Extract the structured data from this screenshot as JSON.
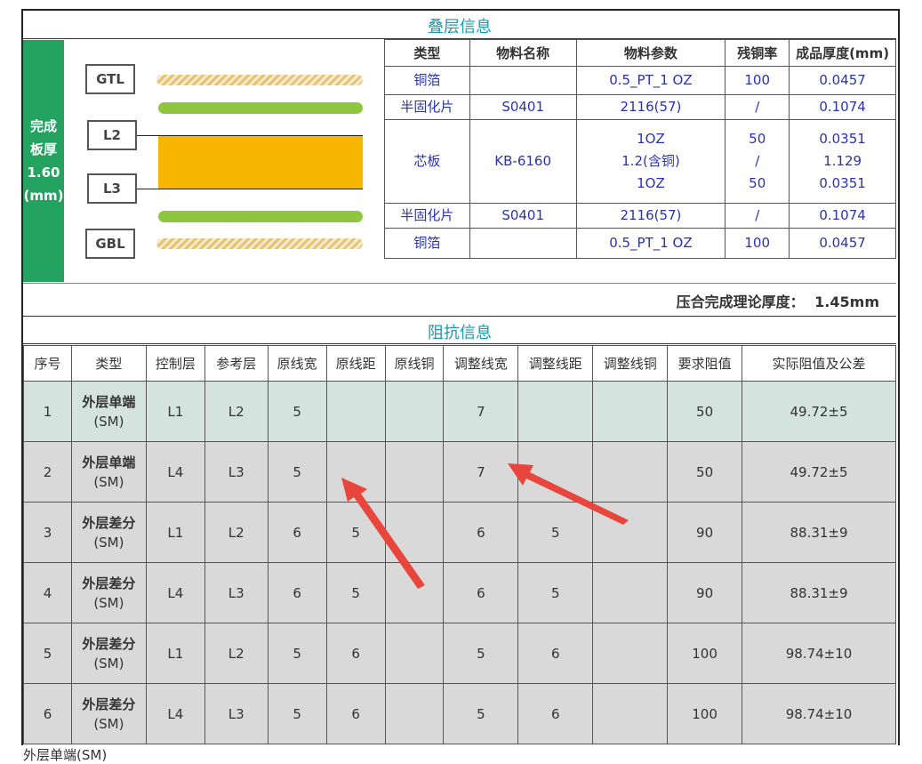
{
  "stack": {
    "title": "叠层信息",
    "side_label": [
      "完成",
      "板厚",
      "1.60",
      "(mm)"
    ],
    "layer_labels": [
      "GTL",
      "L2",
      "L3",
      "GBL"
    ],
    "headers": [
      "类型",
      "物料名称",
      "物料参数",
      "残铜率",
      "成品厚度(mm)"
    ],
    "rows": [
      {
        "type": "铜箔",
        "name": "",
        "param": [
          "0.5_PT_1 OZ"
        ],
        "copper": [
          "100"
        ],
        "thickness": [
          "0.0457"
        ]
      },
      {
        "type": "半固化片",
        "name": "S0401",
        "param": [
          "2116(57)"
        ],
        "copper": [
          "/"
        ],
        "thickness": [
          "0.1074"
        ]
      },
      {
        "type": "芯板",
        "name": "KB-6160",
        "param": [
          "1OZ",
          "1.2(含铜)",
          "1OZ"
        ],
        "copper": [
          "50",
          "/",
          "50"
        ],
        "thickness": [
          "0.0351",
          "1.129",
          "0.0351"
        ]
      },
      {
        "type": "半固化片",
        "name": "S0401",
        "param": [
          "2116(57)"
        ],
        "copper": [
          "/"
        ],
        "thickness": [
          "0.1074"
        ]
      },
      {
        "type": "铜箔",
        "name": "",
        "param": [
          "0.5_PT_1 OZ"
        ],
        "copper": [
          "100"
        ],
        "thickness": [
          "0.0457"
        ]
      }
    ],
    "theory_label": "压合完成理论厚度：",
    "theory_value": "1.45mm"
  },
  "impedance": {
    "title": "阻抗信息",
    "headers": [
      "序号",
      "类型",
      "控制层",
      "参考层",
      "原线宽",
      "原线距",
      "原线铜",
      "调整线宽",
      "调整线距",
      "调整线铜",
      "要求阻值",
      "实际阻值及公差"
    ],
    "rows": [
      {
        "no": "1",
        "type": "外层单端",
        "sub": "(SM)",
        "ctrl": "L1",
        "ref": "L2",
        "ow": "5",
        "os": "",
        "oc": "",
        "aw": "7",
        "as": "",
        "ac": "",
        "req": "50",
        "actual": "49.72±5"
      },
      {
        "no": "2",
        "type": "外层单端",
        "sub": "(SM)",
        "ctrl": "L4",
        "ref": "L3",
        "ow": "5",
        "os": "",
        "oc": "",
        "aw": "7",
        "as": "",
        "ac": "",
        "req": "50",
        "actual": "49.72±5"
      },
      {
        "no": "3",
        "type": "外层差分",
        "sub": "(SM)",
        "ctrl": "L1",
        "ref": "L2",
        "ow": "6",
        "os": "5",
        "oc": "",
        "aw": "6",
        "as": "5",
        "ac": "",
        "req": "90",
        "actual": "88.31±9"
      },
      {
        "no": "4",
        "type": "外层差分",
        "sub": "(SM)",
        "ctrl": "L4",
        "ref": "L3",
        "ow": "6",
        "os": "5",
        "oc": "",
        "aw": "6",
        "as": "5",
        "ac": "",
        "req": "90",
        "actual": "88.31±9"
      },
      {
        "no": "5",
        "type": "外层差分",
        "sub": "(SM)",
        "ctrl": "L1",
        "ref": "L2",
        "ow": "5",
        "os": "6",
        "oc": "",
        "aw": "5",
        "as": "6",
        "ac": "",
        "req": "100",
        "actual": "98.74±10"
      },
      {
        "no": "6",
        "type": "外层差分",
        "sub": "(SM)",
        "ctrl": "L4",
        "ref": "L3",
        "ow": "5",
        "os": "6",
        "oc": "",
        "aw": "5",
        "as": "6",
        "ac": "",
        "req": "100",
        "actual": "98.74±10"
      }
    ]
  },
  "footer_text": "外层单端(SM)",
  "colors": {
    "side_green": "#24a260",
    "title_teal": "#1a9bb0",
    "arrow_red": "#e8453c",
    "core_orange": "#f7b500",
    "prepreg_green": "#8ec63f",
    "row1_bg": "#d5e3df",
    "row_bg": "#d9d9d9"
  }
}
